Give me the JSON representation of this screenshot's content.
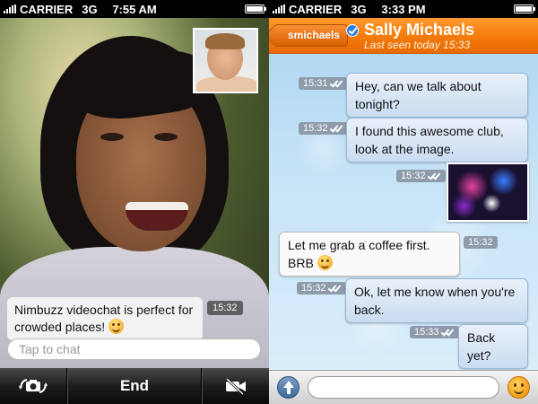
{
  "left_screen": {
    "status": {
      "carrier": "CARRIER",
      "network": "3G",
      "time": "7:55 AM"
    },
    "incoming_message": {
      "text": "Nimbuzz videochat is perfect for crowded places!",
      "time": "15:32"
    },
    "input": {
      "placeholder": "Tap to chat"
    },
    "call_controls": {
      "end_label": "End",
      "rotate_icon": "camera-rotate-icon",
      "camera_icon": "camera-off-icon"
    }
  },
  "right_screen": {
    "status": {
      "carrier": "CARRIER",
      "network": "3G",
      "time": "3:33 PM"
    },
    "header": {
      "back_label": "smichaels",
      "contact_name": "Sally Michaels",
      "last_seen": "Last seen today 15:33",
      "accent": "#f47a0a"
    },
    "messages": [
      {
        "direction": "out",
        "text": "Hey, can we talk about tonight?",
        "time": "15:31"
      },
      {
        "direction": "out",
        "text": "I found this awesome club, look at the image.",
        "time": "15:32"
      },
      {
        "direction": "out",
        "type": "image",
        "time": "15:32"
      },
      {
        "direction": "in",
        "text": "Let me grab a coffee first. BRB",
        "time": "15:32"
      },
      {
        "direction": "out",
        "text": "Ok, let me know when you're back.",
        "time": "15:32"
      },
      {
        "direction": "out",
        "text": "Back yet?",
        "time": "15:33"
      }
    ],
    "input_bar": {
      "upload_icon": "upload-arrow-icon",
      "emoji_icon": "smiley-icon"
    }
  }
}
